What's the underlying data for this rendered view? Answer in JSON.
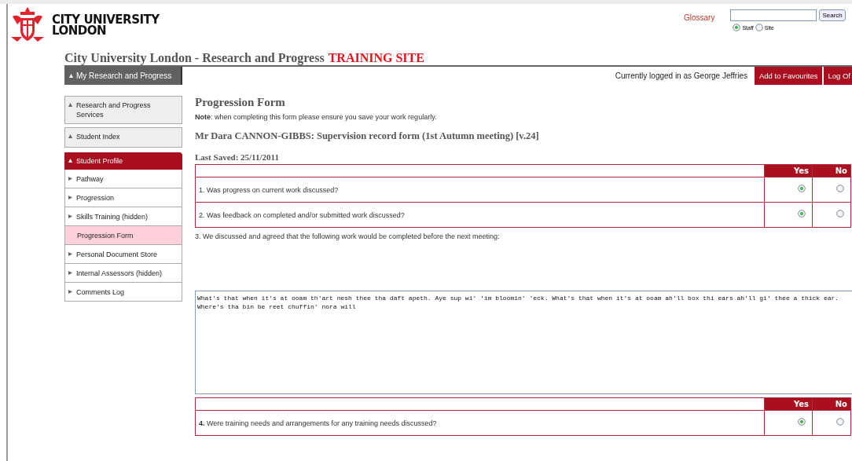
{
  "header": {
    "logo_lines": [
      "CITY UNIVERSITY",
      "LONDON"
    ],
    "glossary": "Glossary",
    "search": {
      "button": "Search"
    },
    "scope": [
      {
        "label": "Staff",
        "selected": true
      },
      {
        "label": "Site",
        "selected": false
      }
    ],
    "site_title": "City University London - Research and Progress",
    "site_badge": "TRAINING SITE"
  },
  "nav": {
    "tab": "My Research and Progress",
    "logged_in": "Currently logged in as George Jeffries",
    "buttons": [
      "Add to Favourites",
      "Log Of"
    ]
  },
  "sidebar": {
    "items": [
      {
        "label": "Research and Progress Services",
        "kind": "panel",
        "selected": false
      },
      {
        "label": "Student Index",
        "kind": "panel",
        "selected": false
      },
      {
        "label": "Student Profile",
        "kind": "header",
        "selected": false
      },
      {
        "label": "Pathway",
        "kind": "link",
        "selected": false
      },
      {
        "label": "Progression",
        "kind": "link",
        "selected": false
      },
      {
        "label": "Skills Training (hidden)",
        "kind": "link",
        "selected": false
      },
      {
        "label": "Progression Form",
        "kind": "sub",
        "selected": true
      },
      {
        "label": "Personal Document Store",
        "kind": "link",
        "selected": false
      },
      {
        "label": "Internal Assessors (hidden)",
        "kind": "link",
        "selected": false
      },
      {
        "label": "Comments Log",
        "kind": "link",
        "selected": false
      }
    ]
  },
  "form": {
    "title": "Progression Form",
    "note": "**Note**: when completing this form please ensure you save your work regularly.",
    "heading": "Mr Dara CANNON-GIBBS: Supervision record form (1st Autumn meeting) [v.24]",
    "last_saved": "Last Saved: 25/11/2011",
    "sections": [
      {
        "kind": "yesno",
        "columns": [
          "Yes",
          "No"
        ],
        "questions": [
          {
            "number": "1.",
            "text": "Was progress on current work discussed?",
            "yes_selected": true,
            "no_selected": false
          },
          {
            "number": "2.",
            "text": "Was feedback on completed and/or submitted work discussed?",
            "yes_selected": true,
            "no_selected": false
          }
        ]
      },
      {
        "kind": "text",
        "number": "3.",
        "text": "We discussed and agreed that the following work would be completed before the next meeting:"
      },
      {
        "kind": "textarea",
        "value": "What's that when it's at ooam th'art nesh thee tha daft apeth. Aye sup wi' 'im bloomin' 'eck. What's that when it's at ooam ah'll box thi ears ah'll gi' thee a thick ear. Where's tha bin be reet chuffin' nora will"
      },
      {
        "kind": "yesno",
        "columns": [
          "Yes",
          "No"
        ],
        "questions": [
          {
            "number": "4.",
            "text": "Were training needs and arrangements for any training needs discussed?",
            "yes_selected": true,
            "no_selected": false
          }
        ]
      }
    ]
  }
}
